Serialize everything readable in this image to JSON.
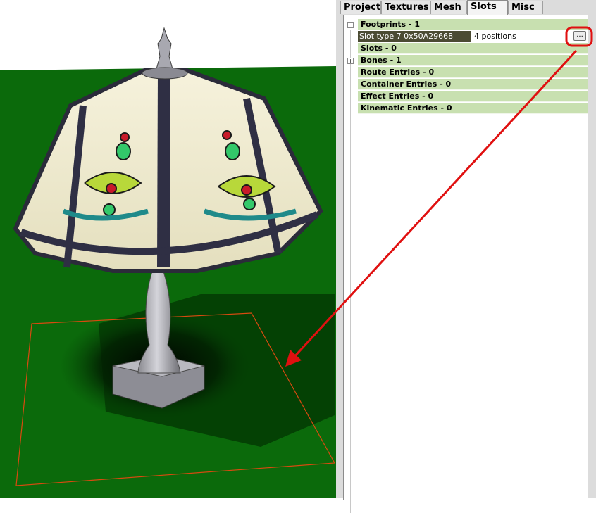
{
  "tabs": [
    {
      "label": "Project"
    },
    {
      "label": "Textures"
    },
    {
      "label": "Mesh"
    },
    {
      "label": "Slots"
    },
    {
      "label": "Misc"
    }
  ],
  "active_tab": "Slots",
  "tree": {
    "footprints": {
      "label": "Footprints - 1",
      "expander": "−"
    },
    "slot_entry": {
      "name": "Slot type 7 0x50A29668",
      "value": "4 positions",
      "button": "..."
    },
    "slots": {
      "label": "Slots - 0"
    },
    "bones": {
      "label": "Bones - 1",
      "expander": "+"
    },
    "route_entries": {
      "label": "Route Entries - 0"
    },
    "container_entries": {
      "label": "Container Entries - 0"
    },
    "effect_entries": {
      "label": "Effect Entries - 0"
    },
    "kinematic_entries": {
      "label": "Kinematic Entries - 0"
    }
  },
  "colors": {
    "ground": "#0b6a0b",
    "row_highlight": "#c8e0b0",
    "annotation": "#e01010",
    "footprint_outline": "#d84a10"
  }
}
